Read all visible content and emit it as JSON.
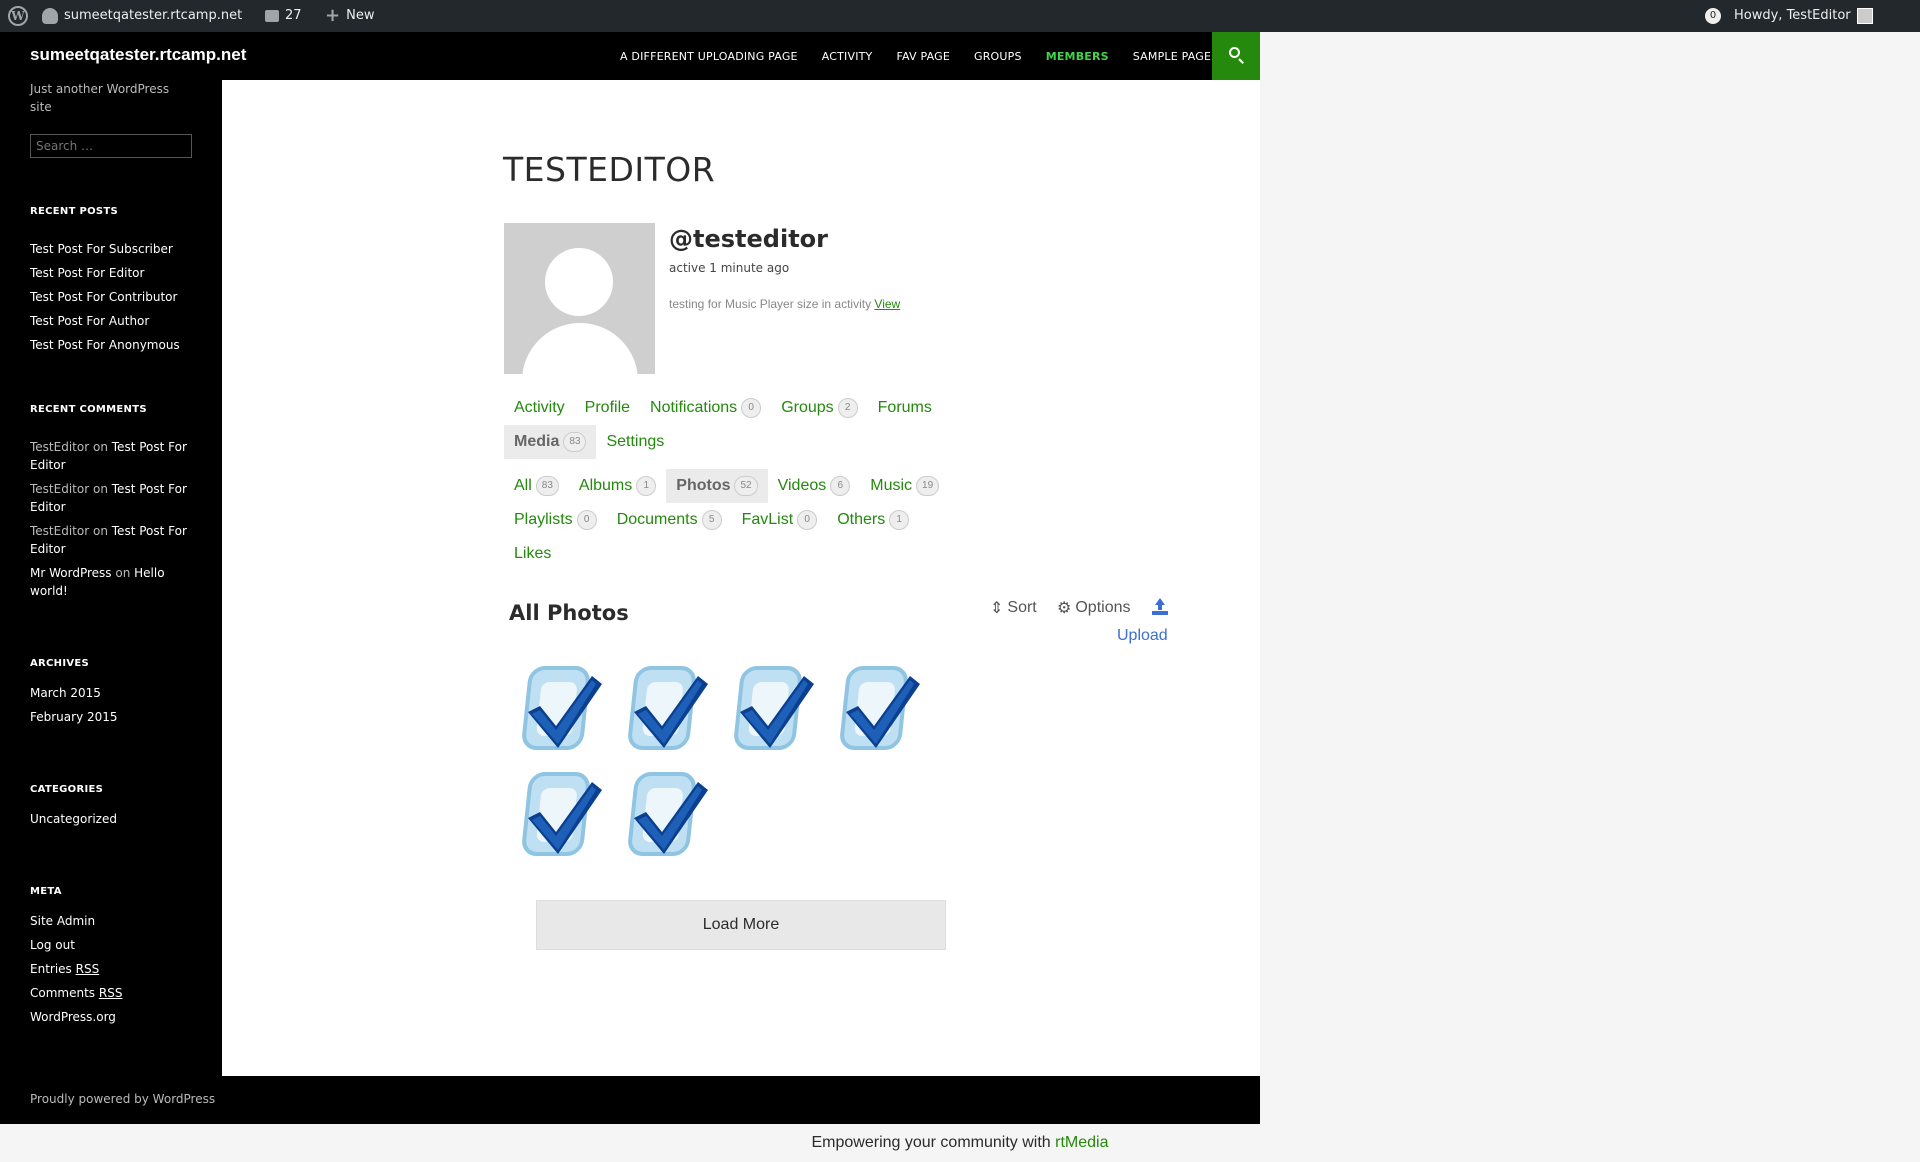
{
  "admin_bar": {
    "wp_logo": "W",
    "site_name": "sumeetqatester.rtcamp.net",
    "comments_count": "27",
    "new_label": "New",
    "notifications_count": "0",
    "howdy": "Howdy, TestEditor"
  },
  "header": {
    "site_title": "sumeetqatester.rtcamp.net",
    "nav": [
      "A DIFFERENT UPLOADING PAGE",
      "ACTIVITY",
      "FAV PAGE",
      "GROUPS",
      "MEMBERS",
      "SAMPLE PAGE"
    ],
    "nav_current": "MEMBERS"
  },
  "sidebar": {
    "tagline": "Just another WordPress site",
    "search_placeholder": "Search …",
    "recent_posts_title": "RECENT POSTS",
    "recent_posts": [
      "Test Post For Subscriber",
      "Test Post For Editor",
      "Test Post For Contributor",
      "Test Post For Author",
      "Test Post For Anonymous"
    ],
    "recent_comments_title": "RECENT COMMENTS",
    "recent_comments": [
      {
        "author": "TestEditor",
        "on": "on",
        "post": "Test Post For Editor"
      },
      {
        "author": "TestEditor",
        "on": "on",
        "post": "Test Post For Editor"
      },
      {
        "author": "TestEditor",
        "on": "on",
        "post": "Test Post For Editor"
      },
      {
        "author": "Mr WordPress",
        "on": "on",
        "post": "Hello world!"
      }
    ],
    "archives_title": "ARCHIVES",
    "archives": [
      "March 2015",
      "February 2015"
    ],
    "categories_title": "CATEGORIES",
    "categories": [
      "Uncategorized"
    ],
    "meta_title": "META",
    "meta": {
      "site_admin": "Site Admin",
      "log_out": "Log out",
      "entries": "Entries",
      "comments": "Comments",
      "rss": "RSS",
      "wordpress_org": "WordPress.org"
    }
  },
  "profile": {
    "page_title": "TESTEDITOR",
    "mention": "@testeditor",
    "last_active": "active 1 minute ago",
    "latest_update": "testing for Music Player size in activity",
    "view_link": "View"
  },
  "main_tabs": [
    {
      "label": "Activity",
      "count": ""
    },
    {
      "label": "Profile",
      "count": ""
    },
    {
      "label": "Notifications",
      "count": "0"
    },
    {
      "label": "Groups",
      "count": "2"
    },
    {
      "label": "Forums",
      "count": ""
    },
    {
      "label": "Media",
      "count": "83",
      "active": true
    },
    {
      "label": "Settings",
      "count": ""
    }
  ],
  "media_tabs": [
    {
      "label": "All",
      "count": "83"
    },
    {
      "label": "Albums",
      "count": "1"
    },
    {
      "label": "Photos",
      "count": "52",
      "active": true
    },
    {
      "label": "Videos",
      "count": "6"
    },
    {
      "label": "Music",
      "count": "19"
    },
    {
      "label": "Playlists",
      "count": "0"
    },
    {
      "label": "Documents",
      "count": "5"
    },
    {
      "label": "FavList",
      "count": "0"
    },
    {
      "label": "Others",
      "count": "1"
    },
    {
      "label": "Likes",
      "count": ""
    }
  ],
  "gallery": {
    "heading": "All Photos",
    "sort_label": "Sort",
    "options_label": "Options",
    "upload_label": "Upload",
    "thumbnail_count": 6,
    "load_more_label": "Load More"
  },
  "footer": {
    "powered": "Proudly powered by WordPress",
    "rtmedia_prefix": "Empowering your community with",
    "rtmedia_link": "rtMedia"
  },
  "colors": {
    "accent_green": "#24890d",
    "nav_current": "#41d34b",
    "upload_blue": "#3b6fd1",
    "admin_bar": "#23282d"
  }
}
